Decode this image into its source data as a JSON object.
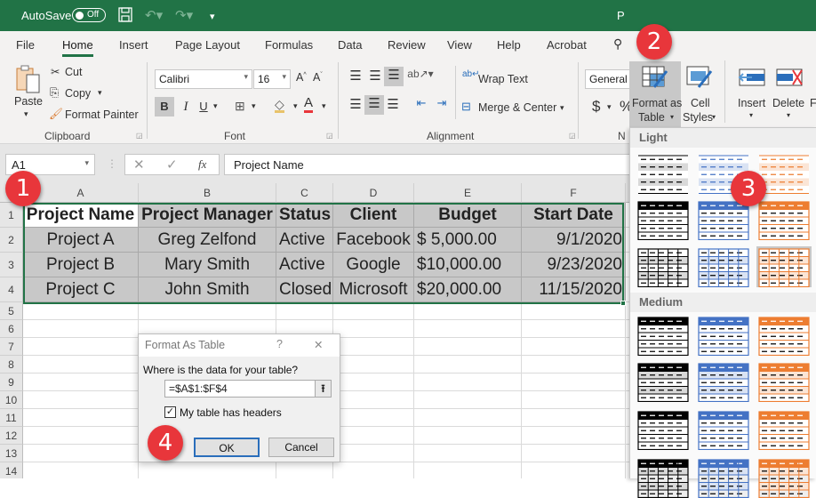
{
  "titlebar": {
    "autosave_label": "AutoSave",
    "autosave_state": "Off",
    "window_title": "P",
    "icons": [
      "save-icon",
      "undo-icon",
      "redo-icon",
      "customize-qat-icon"
    ]
  },
  "tabs": [
    {
      "label": "File"
    },
    {
      "label": "Home",
      "active": true
    },
    {
      "label": "Insert"
    },
    {
      "label": "Page Layout"
    },
    {
      "label": "Formulas"
    },
    {
      "label": "Data"
    },
    {
      "label": "Review"
    },
    {
      "label": "View"
    },
    {
      "label": "Help"
    },
    {
      "label": "Acrobat"
    }
  ],
  "ribbon": {
    "clipboard": {
      "paste": "Paste",
      "cut": "Cut",
      "copy": "Copy",
      "format_painter": "Format Painter",
      "label": "Clipboard"
    },
    "font": {
      "name": "Calibri",
      "size": "16",
      "bold": "B",
      "italic": "I",
      "underline": "U",
      "label": "Font"
    },
    "alignment": {
      "wrap_text": "Wrap Text",
      "merge_center": "Merge & Center",
      "label": "Alignment"
    },
    "number": {
      "format": "General",
      "currency": "$",
      "percent": "%",
      "label": "N"
    },
    "styles": {
      "format_as_table_1": "Format as",
      "format_as_table_2": "Table",
      "cell_styles_1": "Cell",
      "cell_styles_2": "Styles"
    },
    "cells": {
      "insert": "Insert",
      "delete": "Delete",
      "format": "Fo"
    }
  },
  "formula_bar": {
    "name_box": "A1",
    "fx": "fx",
    "value": "Project Name"
  },
  "sheet": {
    "columns": [
      "A",
      "B",
      "C",
      "D",
      "E",
      "F"
    ],
    "rows": [
      "1",
      "2",
      "3",
      "4",
      "5",
      "6",
      "7",
      "8",
      "9",
      "10",
      "11",
      "12",
      "13",
      "14"
    ],
    "headers": [
      "Project Name",
      "Project Manager",
      "Status",
      "Client",
      "Budget",
      "Start Date"
    ],
    "data": [
      [
        "Project A",
        "Greg Zelfond",
        "Active",
        "Facebook",
        "$   5,000.00",
        "9/1/2020"
      ],
      [
        "Project B",
        "Mary Smith",
        "Active",
        "Google",
        "$10,000.00",
        "9/23/2020"
      ],
      [
        "Project C",
        "John Smith",
        "Closed",
        "Microsoft",
        "$20,000.00",
        "11/15/2020"
      ]
    ]
  },
  "gallery": {
    "sections": [
      "Light",
      "Medium"
    ],
    "colors": {
      "black": "#000000",
      "blue": "#4472c4",
      "orange": "#ed7d31",
      "gray": "#d9d9d9",
      "lightblue": "#dae3f3",
      "lightorange": "#fbe5d6"
    }
  },
  "dialog": {
    "title": "Format As Table",
    "help": "?",
    "close": "✕",
    "prompt": "Where is the data for your table?",
    "range": "=$A$1:$F$4",
    "has_headers_label": "My table has headers",
    "has_headers_checked": true,
    "ok": "OK",
    "cancel": "Cancel"
  },
  "badges": [
    "1",
    "2",
    "3",
    "4"
  ]
}
